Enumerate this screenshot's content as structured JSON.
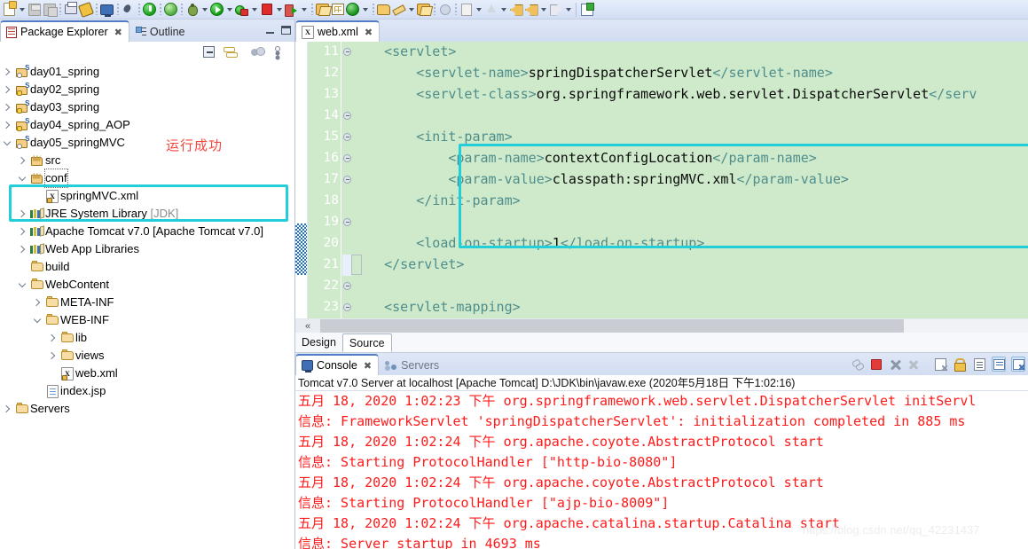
{
  "toolbar": {
    "items": [
      {
        "name": "new-document-button",
        "icon": "new-document-icon",
        "dropdown": true
      },
      {
        "name": "save-button",
        "icon": "save-icon",
        "dropdown": false
      },
      {
        "name": "save-all-button",
        "icon": "save-all-icon",
        "dropdown": false
      },
      {
        "sep": true
      },
      {
        "name": "print-button",
        "icon": "print-icon",
        "dropdown": false
      },
      {
        "name": "build-button",
        "icon": "build-icon",
        "dropdown": false
      },
      {
        "sep": true
      },
      {
        "name": "open-monitor-button",
        "icon": "monitor-icon",
        "dropdown": false
      },
      {
        "sep": true
      },
      {
        "name": "search-button",
        "icon": "search-icon",
        "dropdown": false
      },
      {
        "sep": true
      },
      {
        "name": "run-as-server-button",
        "icon": "green-power-icon",
        "dropdown": false
      },
      {
        "sep": true
      },
      {
        "name": "spring-tool-button",
        "icon": "spring-leaf-icon",
        "dropdown": false
      },
      {
        "sep": true
      },
      {
        "name": "debug-button",
        "icon": "debug-bug-icon",
        "dropdown": true
      },
      {
        "name": "run-button",
        "icon": "run-play-icon",
        "dropdown": true
      },
      {
        "name": "external-tools-button",
        "icon": "external-tools-icon",
        "dropdown": true
      },
      {
        "name": "terminate-button",
        "icon": "terminate-red-icon",
        "dropdown": true
      },
      {
        "name": "run-server-button",
        "icon": "run-server-icon",
        "dropdown": true
      },
      {
        "sep": true
      },
      {
        "name": "open-type-button",
        "icon": "open-folder-icon",
        "dropdown": false
      },
      {
        "name": "new-table-button",
        "icon": "grid-icon",
        "dropdown": false
      },
      {
        "name": "refresh-button",
        "icon": "circle-arrow-icon",
        "dropdown": true
      },
      {
        "sep": true
      },
      {
        "name": "open-resource-button",
        "icon": "folder-open-icon",
        "dropdown": false
      },
      {
        "name": "edit-button",
        "icon": "pencil-icon",
        "dropdown": true
      },
      {
        "name": "open-task-button",
        "icon": "folder-task-icon",
        "dropdown": false
      },
      {
        "sep": true
      },
      {
        "name": "next-annotation-button",
        "icon": "dot-icon",
        "dropdown": false
      },
      {
        "sep": true
      },
      {
        "name": "task-note-button",
        "icon": "note-icon",
        "dropdown": true
      },
      {
        "name": "previous-annotation-button",
        "icon": "up-arrow-icon",
        "dropdown": true
      },
      {
        "name": "back-yellow-button",
        "icon": "yellow-back-arrow-icon",
        "dropdown": false
      },
      {
        "name": "back-button",
        "icon": "yellow-back-arrow-icon",
        "dropdown": true
      },
      {
        "name": "forward-button",
        "icon": "gray-forward-arrow-icon",
        "dropdown": true
      },
      {
        "sepSolid": true
      },
      {
        "name": "new-window-button",
        "icon": "new-window-icon",
        "dropdown": false
      }
    ]
  },
  "left_panel": {
    "tabs": [
      {
        "label": "Package Explorer",
        "icon": "package-explorer-icon",
        "active": true,
        "closable": true
      },
      {
        "label": "Outline",
        "icon": "outline-icon",
        "active": false,
        "closable": false
      }
    ],
    "window_buttons": [
      {
        "name": "minimize-view-button",
        "icon": "minimize-icon"
      },
      {
        "name": "maximize-view-button",
        "icon": "maximize-icon"
      }
    ],
    "view_toolbar": [
      {
        "name": "collapse-all-button",
        "icon": "collapse-all-icon"
      },
      {
        "name": "link-with-editor-button",
        "icon": "link-with-editor-icon"
      },
      {
        "name": "view-filters-button",
        "icon": "filters-icon"
      },
      {
        "name": "view-menu-button",
        "icon": "view-menu-icon"
      }
    ],
    "annotation": "运行成功",
    "tree": [
      {
        "label": "day01_spring",
        "icon": "spring-project-icon",
        "indent": 0,
        "state": "collapsed"
      },
      {
        "label": "day02_spring",
        "icon": "spring-project-warn-icon",
        "indent": 0,
        "state": "collapsed"
      },
      {
        "label": "day03_spring",
        "icon": "spring-project-warn-icon",
        "indent": 0,
        "state": "collapsed"
      },
      {
        "label": "day04_spring_AOP",
        "icon": "spring-project-warn-icon",
        "indent": 0,
        "state": "collapsed"
      },
      {
        "label": "day05_springMVC",
        "icon": "spring-project-icon",
        "indent": 0,
        "state": "expanded"
      },
      {
        "label": "src",
        "icon": "source-folder-icon",
        "indent": 1,
        "state": "collapsed"
      },
      {
        "label": "conf",
        "icon": "source-folder-icon",
        "indent": 1,
        "state": "expanded",
        "focused": true
      },
      {
        "label": "springMVC.xml",
        "icon": "xml-file-icon",
        "indent": 2,
        "state": "leaf"
      },
      {
        "label": "JRE System Library",
        "suffix": " [JDK]",
        "icon": "library-icon",
        "indent": 1,
        "state": "collapsed"
      },
      {
        "label": "Apache Tomcat v7.0 [Apache Tomcat v7.0]",
        "icon": "library-icon",
        "indent": 1,
        "state": "collapsed"
      },
      {
        "label": "Web App Libraries",
        "icon": "library-icon",
        "indent": 1,
        "state": "collapsed"
      },
      {
        "label": "build",
        "icon": "folder-icon",
        "indent": 1,
        "state": "leaf"
      },
      {
        "label": "WebContent",
        "icon": "folder-icon",
        "indent": 1,
        "state": "expanded"
      },
      {
        "label": "META-INF",
        "icon": "folder-icon",
        "indent": 2,
        "state": "collapsed"
      },
      {
        "label": "WEB-INF",
        "icon": "folder-icon",
        "indent": 2,
        "state": "expanded"
      },
      {
        "label": "lib",
        "icon": "folder-icon",
        "indent": 3,
        "state": "collapsed"
      },
      {
        "label": "views",
        "icon": "folder-icon",
        "indent": 3,
        "state": "collapsed"
      },
      {
        "label": "web.xml",
        "icon": "xml-file-icon",
        "indent": 3,
        "state": "leaf"
      },
      {
        "label": "index.jsp",
        "icon": "jsp-file-icon",
        "indent": 2,
        "state": "leaf"
      },
      {
        "label": "Servers",
        "icon": "folder-icon",
        "indent": 0,
        "state": "collapsed"
      }
    ]
  },
  "editor": {
    "tabs": [
      {
        "label": "web.xml",
        "icon": "xml-file-icon",
        "active": true,
        "closable": true
      }
    ],
    "lines": [
      {
        "num": "11",
        "fold": true,
        "segments": [
          {
            "t": "    ",
            "c": "txt"
          },
          {
            "t": "<servlet>",
            "c": "tag"
          }
        ]
      },
      {
        "num": "12",
        "fold": false,
        "segments": [
          {
            "t": "        ",
            "c": "txt"
          },
          {
            "t": "<servlet-name>",
            "c": "tag"
          },
          {
            "t": "springDispatcherServlet",
            "c": "txt"
          },
          {
            "t": "</servlet-name>",
            "c": "tag"
          }
        ]
      },
      {
        "num": "13",
        "fold": false,
        "segments": [
          {
            "t": "        ",
            "c": "txt"
          },
          {
            "t": "<servlet-class>",
            "c": "tag"
          },
          {
            "t": "org.springframework.web.servlet.DispatcherServlet",
            "c": "txt"
          },
          {
            "t": "</serv",
            "c": "tag"
          }
        ]
      },
      {
        "num": "14",
        "fold": true,
        "segments": []
      },
      {
        "num": "15",
        "fold": true,
        "segments": [
          {
            "t": "        ",
            "c": "txt"
          },
          {
            "t": "<init-param>",
            "c": "tag"
          }
        ]
      },
      {
        "num": "16",
        "fold": true,
        "segments": [
          {
            "t": "            ",
            "c": "txt"
          },
          {
            "t": "<param-name>",
            "c": "tag"
          },
          {
            "t": "contextConfigLocation",
            "c": "txt"
          },
          {
            "t": "</param-name>",
            "c": "tag"
          }
        ]
      },
      {
        "num": "17",
        "fold": true,
        "segments": [
          {
            "t": "            ",
            "c": "txt"
          },
          {
            "t": "<param-value>",
            "c": "tag"
          },
          {
            "t": "classpath:springMVC.xml",
            "c": "txt"
          },
          {
            "t": "</param-value>",
            "c": "tag"
          }
        ]
      },
      {
        "num": "18",
        "fold": false,
        "segments": [
          {
            "t": "        ",
            "c": "txt"
          },
          {
            "t": "</init-param>",
            "c": "tag"
          }
        ]
      },
      {
        "num": "19",
        "fold": true,
        "segments": []
      },
      {
        "num": "20",
        "fold": false,
        "segments": [
          {
            "t": "        ",
            "c": "txt"
          },
          {
            "t": "<load-on-startup>",
            "c": "tag"
          },
          {
            "t": "1",
            "c": "txt"
          },
          {
            "t": "</load-on-startup>",
            "c": "tag"
          }
        ]
      },
      {
        "num": "21",
        "fold": false,
        "current": true,
        "segments": [
          {
            "t": "    ",
            "c": "txt"
          },
          {
            "t": "</servlet>",
            "c": "tag"
          }
        ]
      },
      {
        "num": "22",
        "fold": true,
        "segments": []
      },
      {
        "num": "23",
        "fold": true,
        "segments": [
          {
            "t": "    ",
            "c": "txt"
          },
          {
            "t": "<servlet-mapping>",
            "c": "tag"
          }
        ]
      }
    ],
    "bottom_tabs": [
      {
        "label": "Design",
        "active": false
      },
      {
        "label": "Source",
        "active": true
      }
    ]
  },
  "console": {
    "tabs": [
      {
        "label": "Console",
        "icon": "console-icon",
        "active": true,
        "closable": true
      },
      {
        "label": "Servers",
        "icon": "servers-view-icon",
        "active": false,
        "closable": false
      }
    ],
    "tools": [
      {
        "name": "pin-console-button",
        "icon": "pin-icon",
        "boxed": false
      },
      {
        "name": "terminate-button",
        "icon": "terminate-icon",
        "boxed": false
      },
      {
        "name": "remove-launch-button",
        "icon": "remove-icon",
        "boxed": false
      },
      {
        "name": "remove-all-terminated-button",
        "icon": "remove-all-icon",
        "boxed": false
      },
      {
        "name": "clear-console-button",
        "icon": "clear-console-icon",
        "boxed": false
      },
      {
        "name": "scroll-lock-button",
        "icon": "scroll-lock-icon",
        "boxed": false
      },
      {
        "name": "word-wrap-button",
        "icon": "word-wrap-icon",
        "boxed": false
      },
      {
        "name": "display-selected-console-button",
        "icon": "display-console-icon",
        "boxed": true
      },
      {
        "name": "open-console-button",
        "icon": "open-console-icon",
        "boxed": true
      }
    ],
    "header": "Tomcat v7.0 Server at localhost [Apache Tomcat] D:\\JDK\\bin\\javaw.exe  (2020年5月18日 下午1:02:16)",
    "output": [
      "五月 18, 2020 1:02:23 下午 org.springframework.web.servlet.DispatcherServlet initServl",
      "信息: FrameworkServlet 'springDispatcherServlet': initialization completed in 885 ms",
      "五月 18, 2020 1:02:24 下午 org.apache.coyote.AbstractProtocol start",
      "信息: Starting ProtocolHandler [\"http-bio-8080\"]",
      "五月 18, 2020 1:02:24 下午 org.apache.coyote.AbstractProtocol start",
      "信息: Starting ProtocolHandler [\"ajp-bio-8009\"]",
      "五月 18, 2020 1:02:24 下午 org.apache.catalina.startup.Catalina start",
      "信息: Server startup in 4693 ms"
    ]
  },
  "scroll": {
    "editor_hscroll_back_label": "«"
  },
  "watermark": "https://blog.csdn.net/qq_42231437",
  "colors": {
    "highlight_box": "#22cfd8",
    "annotation_red": "#f4453e",
    "editor_background": "#cfeacb",
    "console_text": "#ff1a1a",
    "xml_tag": "#4e8d8c"
  }
}
